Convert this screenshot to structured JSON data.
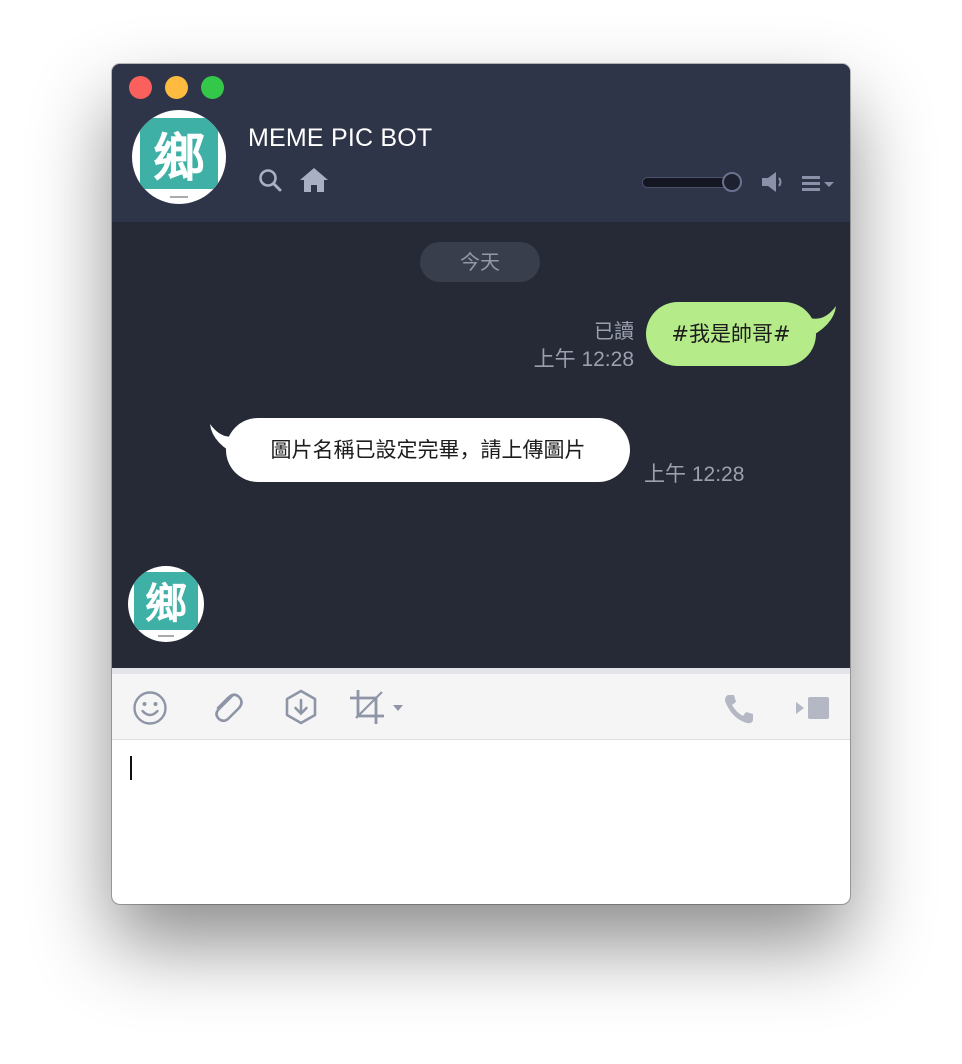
{
  "window": {
    "title": "MEME PIC BOT",
    "avatar_glyph": "鄉",
    "volume_level": 0.9
  },
  "chat": {
    "date_label": "今天",
    "messages": [
      {
        "direction": "outgoing",
        "text": "#我是帥哥#",
        "read_status": "已讀",
        "time": "上午 12:28",
        "bubble_color": "#b6eb8a"
      },
      {
        "direction": "incoming",
        "text": "圖片名稱已設定完畢，請上傳圖片",
        "time": "上午 12:28",
        "bubble_color": "#ffffff"
      }
    ]
  },
  "toolbar": {
    "icons": [
      "emoji-icon",
      "paperclip-icon",
      "keep-icon",
      "crop-icon",
      "phone-icon",
      "video-call-icon"
    ]
  },
  "input": {
    "value": ""
  },
  "colors": {
    "header_bg": "#2f3548",
    "chat_bg": "#262a36",
    "accent_green": "#b6eb8a",
    "avatar_teal": "#3fb0a6"
  }
}
